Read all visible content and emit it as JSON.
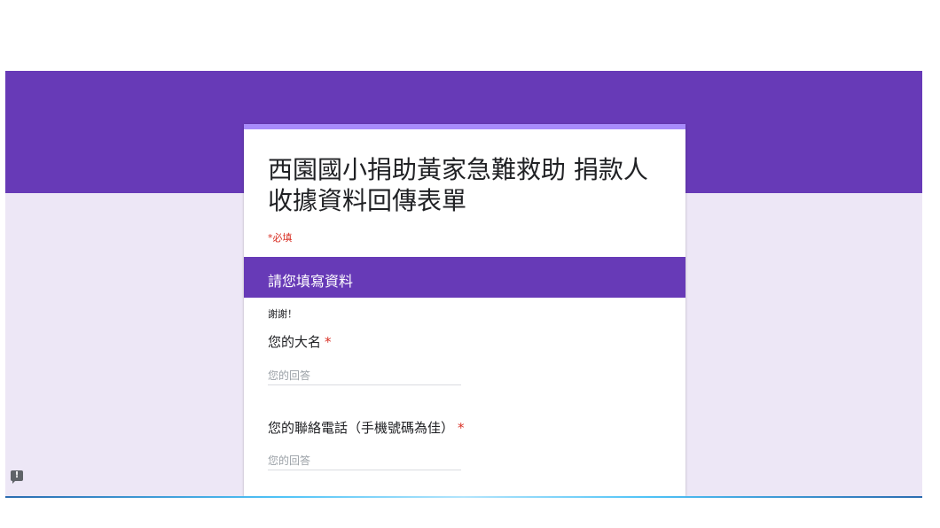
{
  "colors": {
    "theme": "#673ab7",
    "accent_strip": "#a78bfa",
    "page_background": "#ede7f6",
    "required": "#d93025"
  },
  "form": {
    "title": "西園國小捐助黃家急難救助 捐款人收據資料回傳表單",
    "required_note": "*必填"
  },
  "section": {
    "title": "請您填寫資料",
    "description": "謝謝！"
  },
  "questions": [
    {
      "label": "您的大名",
      "required_mark": "*",
      "placeholder": "您的回答",
      "value": ""
    },
    {
      "label": "您的聯絡電話（手機號碼為佳）",
      "required_mark": "*",
      "placeholder": "您的回答",
      "value": ""
    }
  ],
  "report_button": {
    "icon": "feedback-icon",
    "glyph": "!"
  }
}
